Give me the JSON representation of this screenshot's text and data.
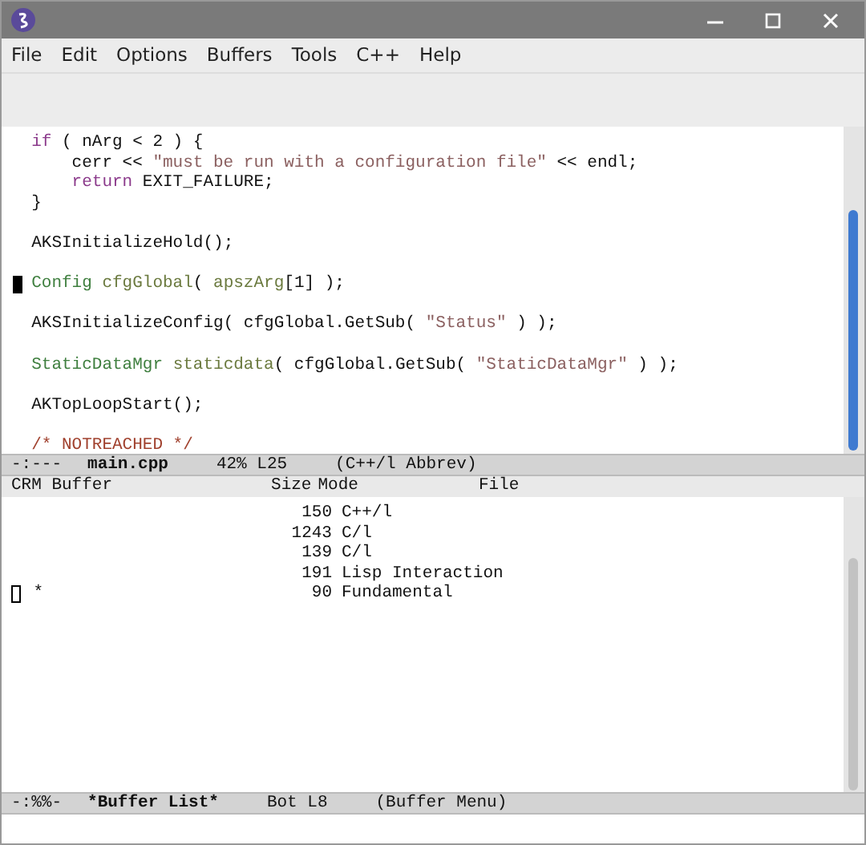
{
  "menu": [
    "File",
    "Edit",
    "Options",
    "Buffers",
    "Tools",
    "C++",
    "Help"
  ],
  "editor": {
    "lines": [
      {
        "kind": "code",
        "segments": [
          {
            "kind": "keyword",
            "text": "if"
          },
          {
            "kind": "plain",
            "space_before": true,
            "text": "( nArg < 2 ) {"
          }
        ],
        "children": [
          {
            "kind": "code",
            "segments": [
              {
                "kind": "plain",
                "text": "cerr <<"
              },
              {
                "kind": "string",
                "space_before": true,
                "text": "\"must be run with a configuration file\""
              },
              {
                "kind": "plain",
                "space_before": true,
                "text": "<< endl;"
              }
            ]
          },
          {
            "kind": "code",
            "segments": [
              {
                "kind": "keyword",
                "text": "return"
              },
              {
                "kind": "plain",
                "space_before": true,
                "text": "EXIT_FAILURE;"
              }
            ]
          }
        ]
      },
      {
        "kind": "code",
        "segments": [
          {
            "kind": "plain",
            "text": "}"
          }
        ]
      },
      {
        "kind": "blank"
      },
      {
        "kind": "code",
        "segments": [
          {
            "kind": "plain",
            "text": "AKSInitializeHold();"
          }
        ]
      },
      {
        "kind": "blank"
      },
      {
        "kind": "code",
        "cursor": true,
        "segments": [
          {
            "kind": "type",
            "text": "Config"
          },
          {
            "kind": "variable",
            "space_before": true,
            "text": "cfgGlobal"
          },
          {
            "kind": "plain",
            "text": "("
          },
          {
            "kind": "variable",
            "space_before": true,
            "text": "apszArg"
          },
          {
            "kind": "plain",
            "text": "[1] );"
          }
        ]
      },
      {
        "kind": "blank"
      },
      {
        "kind": "code",
        "segments": [
          {
            "kind": "plain",
            "text": "AKSInitializeConfig( cfgGlobal.GetSub("
          },
          {
            "kind": "string",
            "space_before": true,
            "text": "\"Status\""
          },
          {
            "kind": "plain",
            "space_before": true,
            "text": ") );"
          }
        ]
      },
      {
        "kind": "blank"
      },
      {
        "kind": "code",
        "segments": [
          {
            "kind": "type",
            "text": "StaticDataMgr"
          },
          {
            "kind": "variable",
            "space_before": true,
            "text": "staticdata"
          },
          {
            "kind": "plain",
            "text": "( cfgGlobal.GetSub("
          },
          {
            "kind": "string",
            "space_before": true,
            "text": "\"StaticDataMgr\""
          },
          {
            "kind": "plain",
            "space_before": true,
            "text": ") );"
          }
        ]
      },
      {
        "kind": "blank"
      },
      {
        "kind": "code",
        "segments": [
          {
            "kind": "plain",
            "text": "AKTopLoopStart();"
          }
        ]
      },
      {
        "kind": "blank"
      },
      {
        "kind": "code",
        "segments": [
          {
            "kind": "comment",
            "text": "/* NOTREACHED */"
          }
        ]
      }
    ],
    "mode_line": {
      "status": "-:---",
      "buffer": "main.cpp",
      "position": "42% L25",
      "mode": "(C++/l Abbrev)"
    }
  },
  "buffer_list": {
    "columns": [
      "CRM Buffer",
      "Size",
      "Mode",
      "File"
    ],
    "rows": [
      {
        "cursor": false,
        "size": "150",
        "mode": "C++/l"
      },
      {
        "cursor": false,
        "size": "1243",
        "mode": "C/l"
      },
      {
        "cursor": false,
        "size": "139",
        "mode": "C/l"
      },
      {
        "cursor": false,
        "size": "191",
        "mode": "Lisp Interaction"
      },
      {
        "cursor": true,
        "marker": "*",
        "size": "90",
        "mode": "Fundamental"
      }
    ],
    "mode_line": {
      "status": "-:%%-",
      "buffer": "*Buffer List*",
      "position": "Bot L8",
      "mode": "(Buffer Menu)"
    }
  }
}
